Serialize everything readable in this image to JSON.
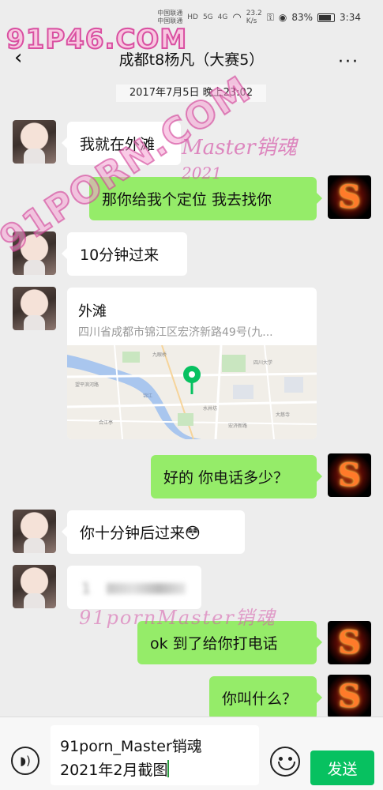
{
  "status_bar": {
    "carrier_1": "中国联通",
    "carrier_2": "中国联通",
    "hd": "HD",
    "net_1": "5G",
    "net_2": "4G",
    "speed_value": "23.2",
    "speed_unit": "K/s",
    "battery": "83%",
    "time": "3:34"
  },
  "header": {
    "title": "成都t8杨凡（大赛5）",
    "more": "···"
  },
  "timestamp": "2017年7月5日 晚上23:02",
  "messages": [
    {
      "side": "in",
      "text": "我就在外滩"
    },
    {
      "side": "out",
      "text": "那你给我个定位 我去找你"
    },
    {
      "side": "in",
      "text": "10分钟过来"
    },
    {
      "side": "in",
      "type": "location",
      "name": "外滩",
      "address": "四川省成都市锦江区宏济新路49号(九..."
    },
    {
      "side": "out",
      "text": "好的 你电话多少？"
    },
    {
      "side": "in",
      "text": "你十分钟后过来😳"
    },
    {
      "side": "in",
      "type": "blurred",
      "text": "1"
    },
    {
      "side": "out",
      "text": "ok 到了给你打电话"
    },
    {
      "side": "out",
      "text": "你叫什么？"
    }
  ],
  "map": {
    "labels": [
      "九眼桥",
      "望平滨河路",
      "四川大学",
      "锦江",
      "水井坊",
      "合江亭",
      "宏济新路",
      "大慈寺"
    ],
    "pin_color": "#07c160"
  },
  "avatars": {
    "self_letter": "S"
  },
  "watermarks": {
    "top": "91P46.COM",
    "diagonal": "91PORN.COM",
    "middle": "Master销魂",
    "middle_year": "2021",
    "bottom": "91pornMaster销魂"
  },
  "input": {
    "text": "91porn_Master销魂\n2021年2月截图",
    "send_label": "发送"
  },
  "colors": {
    "out_bubble": "#95ec69",
    "in_bubble": "#ffffff",
    "background": "#ededed",
    "send": "#07c160"
  }
}
